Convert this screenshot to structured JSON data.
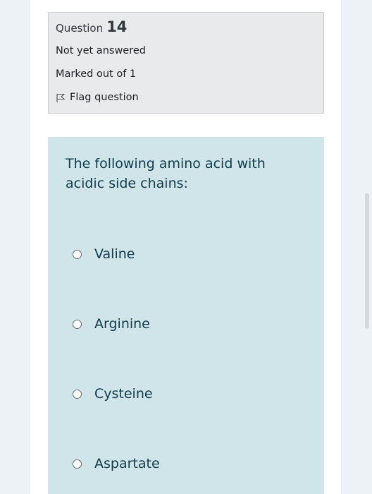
{
  "question_info": {
    "question_word": "Question",
    "question_number": "14",
    "status": "Not yet answered",
    "marks": "Marked out of 1",
    "flag_label": "Flag question"
  },
  "question": {
    "text": "The following amino acid with acidic side chains:",
    "options": [
      {
        "label": "Valine"
      },
      {
        "label": "Arginine"
      },
      {
        "label": "Cysteine"
      },
      {
        "label": "Aspartate"
      }
    ]
  },
  "icons": {
    "flag": "flag-outline-icon"
  },
  "colors": {
    "info_box_bg": "#e8eaec",
    "question_box_bg": "#cfe5ea",
    "question_text": "#123b4a",
    "page_bg": "#edf2f7"
  }
}
